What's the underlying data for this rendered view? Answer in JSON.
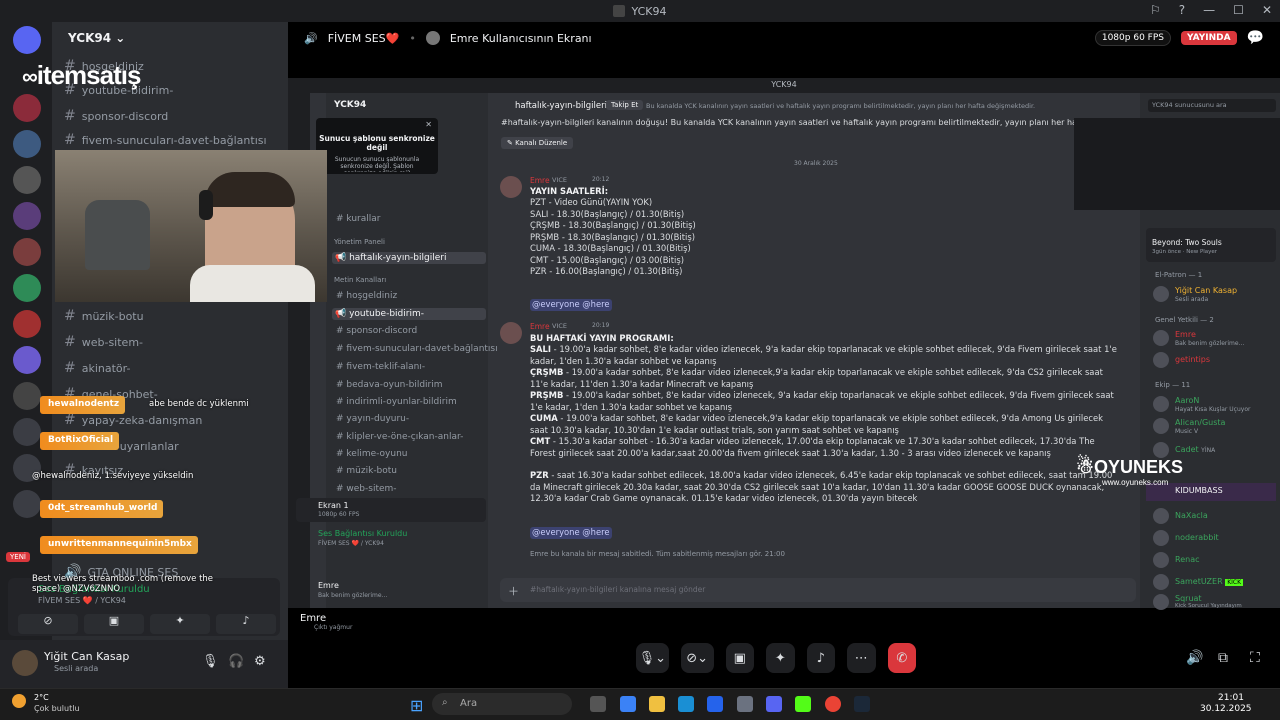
{
  "window": {
    "title": "YCK94"
  },
  "stream_header": {
    "server": "FİVEM SES❤️",
    "screen_owner": "Emre Kullanıcısının Ekranı",
    "quality": "1080p 60 FPS",
    "live": "YAYINDA"
  },
  "sidebar": {
    "server_name": "YCK94",
    "channels": [
      {
        "name": "hoşgeldiniz"
      },
      {
        "name": "youtube-bidirim-"
      },
      {
        "name": "sponsor-discord"
      },
      {
        "name": "fivem-sunucuları-davet-bağlantısı"
      },
      {
        "name": "müzik-botu"
      },
      {
        "name": "web-sitem-"
      },
      {
        "name": "akinatör-"
      },
      {
        "name": "genel-sohbet-"
      },
      {
        "name": "yapay-zeka-danışman"
      },
      {
        "name": "ver-ve-uyarılanlar"
      },
      {
        "name": "kayıtsız"
      },
      {
        "name": "GTA ONLINE SES"
      }
    ]
  },
  "overlay": {
    "logo": "itemsatış",
    "chat": [
      {
        "user": "hewalnodentz",
        "text": "abe bende dc yüklenmi"
      },
      {
        "user": "BotRixOficial",
        "text": "@hewalnodeniz, 1.seviyeye yükseldin"
      },
      {
        "user": "0dt_streamhub_world",
        "text": ""
      },
      {
        "user": "unwrittenmannequinin5mbx",
        "text": "Best viewers streamboo .com (remove the space) @NZV6ZNNO"
      }
    ],
    "new_badge": "YENİ"
  },
  "voice_panel": {
    "title": "Ses Bağlantısı Kuruldu",
    "subtitle": "FİVEM SES ❤️ / YCK94"
  },
  "user_panel": {
    "name": "Yiğit Can Kasap",
    "status": "Sesli arada"
  },
  "inner": {
    "title": "YCK94",
    "server_name": "YCK94",
    "popup_title": "Sunucu şablonu senkronize değil",
    "popup_body": "Sunucun sunucu şablonunla senkronize değil. Şablon senkronize edilsin mi?",
    "channels": [
      {
        "name": "kurallar"
      },
      {
        "name": "Yönetim Paneli"
      },
      {
        "name": "haftalık-yayın-bilgileri",
        "active": true
      },
      {
        "name": "Metin Kanalları"
      },
      {
        "name": "hoşgeldiniz"
      },
      {
        "name": "youtube-bidirim-"
      },
      {
        "name": "sponsor-discord"
      },
      {
        "name": "fivem-sunucuları-davet-bağlantısı"
      },
      {
        "name": "fivem-teklif-alanı-"
      },
      {
        "name": "bedava-oyun-bildirim"
      },
      {
        "name": "indirimli-oyunlar-bildirim"
      },
      {
        "name": "yayın-duyuru-"
      },
      {
        "name": "klipler-ve-öne-çıkan-anlar-"
      },
      {
        "name": "kelime-oyunu"
      },
      {
        "name": "müzik-botu"
      },
      {
        "name": "web-sitem-"
      }
    ],
    "screen_card": {
      "title": "Ekran 1",
      "sub": "1080p 60 FPS"
    },
    "voice": {
      "title": "Ses Bağlantısı Kuruldu",
      "sub": "FİVEM SES ❤️ / YCK94"
    },
    "user": {
      "name": "Emre",
      "status": "Bak benim gözlerime..."
    },
    "channel_header": "haftalık-yayın-bilgileri",
    "follow": "Takip Et",
    "topic": "Bu kanalda YCK kanalının yayın saatleri ve haftalık yayın programı belirtilmektedir, yayın planı her hafta değişmektedir.",
    "search": "YCK94 sunucusunu ara",
    "intro": "#haftalık-yayın-bilgileri kanalının doğuşu! Bu kanalda YCK kanalının yayın saatleri ve haftalık yayın programı belirtilmektedir, yayın planı her hafta değişmektedir.",
    "edit_channel": "Kanalı Düzenle",
    "date_divider": "30 Aralık 2025",
    "msg1": {
      "author": "Emre",
      "tag": "VICE",
      "time": "20:12",
      "lines": [
        "YAYIN SAATLERİ:",
        "PZT - Video Günü(YAYIN YOK)",
        "SALI - 18.30(Başlangıç) / 01.30(Bitiş)",
        "ÇRŞMB - 18.30(Başlangıç) / 01.30(Bitiş)",
        "PRŞMB - 18.30(Başlangıç) / 01.30(Bitiş)",
        "CUMA - 18.30(Başlangıç) / 01.30(Bitiş)",
        "CMT - 15.00(Başlangıç) / 03.00(Bitiş)",
        "PZR - 16.00(Başlangıç) / 01.30(Bitiş)"
      ],
      "mentions": "@everyone @here"
    },
    "msg2": {
      "author": "Emre",
      "tag": "VICE",
      "time": "20:19",
      "heading": "BU HAFTAKİ YAYIN PROGRAMI:",
      "paragraphs": [
        {
          "day": "SALI",
          "text": " - 19.00'a kadar sohbet, 8'e kadar video izlenecek, 9'a kadar ekip toparlanacak ve ekiple sohbet edilecek, 9'da Fivem girilecek saat 1'e kadar, 1'den 1.30'a kadar sohbet ve kapanış"
        },
        {
          "day": "ÇRŞMB",
          "text": " - 19.00'a kadar sohbet, 8'e kadar video izlenecek,9'a kadar ekip toparlanacak ve ekiple sohbet edilecek, 9'da CS2 girilecek saat 11'e kadar, 11'den 1.30'a kadar Minecraft ve kapanış"
        },
        {
          "day": "PRŞMB",
          "text": " - 19.00'a kadar sohbet, 8'e kadar video izlenecek, 9'a kadar ekip toparlanacak ve ekiple sohbet edilecek, 9'da Fivem girilecek saat 1'e kadar, 1'den 1.30'a kadar sohbet ve kapanış"
        },
        {
          "day": "CUMA",
          "text": " - 19.00'a kadar sohbet, 8'e kadar video izlenecek,9'a kadar ekip toparlanacak ve ekiple sohbet edilecek, 9'da Among Us girilecek saat 10.30'a kadar, 10.30'dan 1'e kadar outlast trials, son yarım saat sohbet ve kapanış"
        },
        {
          "day": "CMT",
          "text": " - 15.30'a kadar sohbet - 16.30'a kadar video izlenecek, 17.00'da ekip toplanacak ve 17.30'a kadar sohbet edilecek, 17.30'da The Forest girilecek saat 20.00'a kadar,saat 20.00'da fivem girilecek saat 1.30'a kadar, 1.30 - 3 arası video izlenecek ve kapanış"
        },
        {
          "day": "PZR",
          "text": " - saat 16.30'a kadar sohbet edilecek, 18.00'a kadar video izlenecek, 6.45'e kadar ekip toplanacak ve sohbet edilecek, saat tam 19.00 da Minecraft girilecek 20.30a kadar, saat 20.30'da CS2 girilecek saat 10'a kadar, 10'dan 11.30'a kadar GOOSE GOOSE DUCK oynanacak, 12.30'a kadar Crab Game oynanacak. 01.15'e kadar video izlenecek, 01.30'da yayın bitecek"
        }
      ],
      "mentions": "@everyone @here"
    },
    "pinned_notice": "Emre bu kanala bir mesaj sabitledi. Tüm sabitlenmiş mesajları gör. 21:00",
    "composer_placeholder": "#haftalık-yayın-bilgileri kanalına mesaj gönder",
    "members": {
      "activity": {
        "title": "Beyond: Two Souls",
        "sub": "3gün önce · New Player"
      },
      "sections": [
        {
          "label": "El-Patron — 1",
          "members": [
            {
              "name": "Yiğit Can Kasap",
              "status": "Sesli arada"
            }
          ]
        },
        {
          "label": "Genel Yetkili — 2",
          "members": [
            {
              "name": "Emre",
              "status": "Bak benim gözlerime..."
            },
            {
              "name": "getintips",
              "status": ""
            }
          ]
        },
        {
          "label": "Ekip — 11",
          "members": [
            {
              "name": "AaroN",
              "status": "Hayat Kısa Kuşlar Uçuyor"
            },
            {
              "name": "Alican/Gusta",
              "status": "Music V"
            },
            {
              "name": "Cadet",
              "status": "YİNA"
            },
            {
              "name": "KIDUMBASS",
              "status": ""
            },
            {
              "name": "NaXacla",
              "status": ""
            },
            {
              "name": "noderabbit",
              "status": ""
            },
            {
              "name": "Renac",
              "status": ""
            },
            {
              "name": "SametUZER",
              "status": "KICK"
            },
            {
              "name": "Sqruat",
              "status": "Kick Sorucul Yayındayım"
            }
          ]
        }
      ]
    }
  },
  "oyuneks_watermark": "OYUNEKS",
  "oyuneks_url": "www.oyuneks.com",
  "inner_user_overlay": {
    "name": "Emre",
    "status": "Çıktı yağmur"
  },
  "taskbar": {
    "weather_temp": "2°C",
    "weather_desc": "Çok bulutlu",
    "search": "Ara",
    "time": "21:01",
    "date": "30.12.2025"
  },
  "colors": {
    "accent": "#5865f2",
    "live": "#da373c",
    "bg": "#1e1f22",
    "orange": "#f08c1e"
  }
}
